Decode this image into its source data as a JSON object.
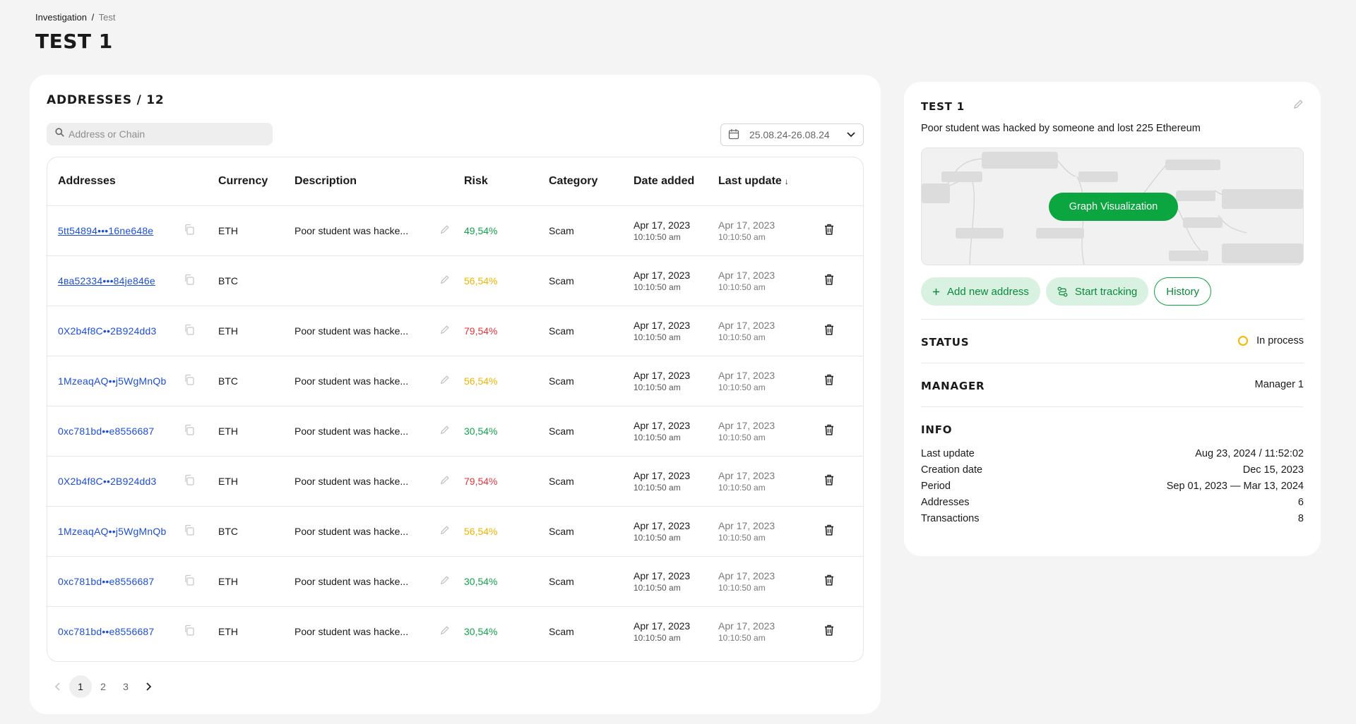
{
  "breadcrumb": {
    "root": "Investigation",
    "separator": "/",
    "current": "Test"
  },
  "page_title": "TEST 1",
  "addresses": {
    "title": "ADDRESSES / 12",
    "search_placeholder": "Address or Chain",
    "date_range": "25.08.24-26.08.24",
    "columns": {
      "address": "Addresses",
      "currency": "Currency",
      "description": "Description",
      "risk": "Risk",
      "category": "Category",
      "date_added": "Date added",
      "last_update": "Last update",
      "sort_indicator": "↓"
    },
    "rows": [
      {
        "address": "5tt54894•••16ne648e",
        "underline": true,
        "currency": "ETH",
        "description": "Poor student was hacke...",
        "risk": "49,54%",
        "risk_color": "green",
        "category": "Scam",
        "date": "Apr 17, 2023",
        "time": "10:10:50 am",
        "upd_date": "Apr 17, 2023",
        "upd_time": "10:10:50 am"
      },
      {
        "address": "4ва52334•••84je846e",
        "underline": true,
        "currency": "BTC",
        "description": "",
        "risk": "56,54%",
        "risk_color": "orange",
        "category": "Scam",
        "date": "Apr 17, 2023",
        "time": "10:10:50 am",
        "upd_date": "Apr 17, 2023",
        "upd_time": "10:10:50 am"
      },
      {
        "address": "0X2b4f8C••2B924dd3",
        "underline": false,
        "currency": "ETH",
        "description": "Poor student was hacke...",
        "risk": "79,54%",
        "risk_color": "red",
        "category": "Scam",
        "date": "Apr 17, 2023",
        "time": "10:10:50 am",
        "upd_date": "Apr 17, 2023",
        "upd_time": "10:10:50 am"
      },
      {
        "address": "1MzeaqAQ••j5WgMnQb",
        "underline": false,
        "currency": "BTC",
        "description": "Poor student was hacke...",
        "risk": "56,54%",
        "risk_color": "orange",
        "category": "Scam",
        "date": "Apr 17, 2023",
        "time": "10:10:50 am",
        "upd_date": "Apr 17, 2023",
        "upd_time": "10:10:50 am"
      },
      {
        "address": "0xc781bd••e8556687",
        "underline": false,
        "currency": "ETH",
        "description": "Poor student was hacke...",
        "risk": "30,54%",
        "risk_color": "green",
        "category": "Scam",
        "date": "Apr 17, 2023",
        "time": "10:10:50 am",
        "upd_date": "Apr 17, 2023",
        "upd_time": "10:10:50 am"
      },
      {
        "address": "0X2b4f8C••2B924dd3",
        "underline": false,
        "currency": "ETH",
        "description": "Poor student was hacke...",
        "risk": "79,54%",
        "risk_color": "red",
        "category": "Scam",
        "date": "Apr 17, 2023",
        "time": "10:10:50 am",
        "upd_date": "Apr 17, 2023",
        "upd_time": "10:10:50 am"
      },
      {
        "address": "1MzeaqAQ••j5WgMnQb",
        "underline": false,
        "currency": "BTC",
        "description": "Poor student was hacke...",
        "risk": "56,54%",
        "risk_color": "orange",
        "category": "Scam",
        "date": "Apr 17, 2023",
        "time": "10:10:50 am",
        "upd_date": "Apr 17, 2023",
        "upd_time": "10:10:50 am"
      },
      {
        "address": "0xc781bd••e8556687",
        "underline": false,
        "currency": "ETH",
        "description": "Poor student was hacke...",
        "risk": "30,54%",
        "risk_color": "green",
        "category": "Scam",
        "date": "Apr 17, 2023",
        "time": "10:10:50 am",
        "upd_date": "Apr 17, 2023",
        "upd_time": "10:10:50 am"
      },
      {
        "address": "0xc781bd••e8556687",
        "underline": false,
        "currency": "ETH",
        "description": "Poor student was hacke...",
        "risk": "30,54%",
        "risk_color": "green",
        "category": "Scam",
        "date": "Apr 17, 2023",
        "time": "10:10:50 am",
        "upd_date": "Apr 17, 2023",
        "upd_time": "10:10:50 am"
      }
    ],
    "pagination": {
      "pages": [
        "1",
        "2",
        "3"
      ],
      "current": "1"
    }
  },
  "case": {
    "title": "TEST 1",
    "description": "Poor student was hacked by someone and lost 225 Ethereum",
    "graph_button": "Graph Visualization",
    "actions": {
      "add": "Add new address",
      "track": "Start tracking",
      "history": "History"
    },
    "status_label": "STATUS",
    "status_value": "In process",
    "status_color": "#f5b800",
    "manager_label": "MANAGER",
    "manager_value": "Manager 1",
    "info_label": "INFO",
    "info": [
      {
        "label": "Last update",
        "value": "Aug 23, 2024 / 11:52:02"
      },
      {
        "label": "Creation date",
        "value": "Dec 15, 2023"
      },
      {
        "label": "Period",
        "value": "Sep 01, 2023 — Mar 13, 2024"
      },
      {
        "label": "Addresses",
        "value": "6"
      },
      {
        "label": "Transactions",
        "value": "8"
      }
    ]
  },
  "colors": {
    "accent": "#0ca640",
    "link": "#1d4fd8",
    "risk_green": "#10a34a",
    "risk_orange": "#f0b400",
    "risk_red": "#e5353a"
  }
}
